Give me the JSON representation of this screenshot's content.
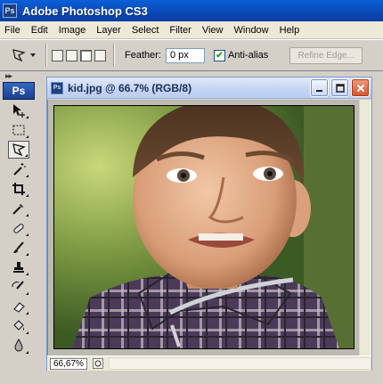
{
  "app": {
    "title": "Adobe Photoshop CS3",
    "logo_text": "Ps"
  },
  "menu": {
    "items": [
      "File",
      "Edit",
      "Image",
      "Layer",
      "Select",
      "Filter",
      "View",
      "Window",
      "Help"
    ]
  },
  "options": {
    "feather_label": "Feather:",
    "feather_value": "0 px",
    "antialias_label": "Anti-alias",
    "antialias_checked": true,
    "refine_edge_label": "Refine Edge..."
  },
  "toolbox": {
    "grip": "▸▸",
    "logo_text": "Ps",
    "tools": [
      {
        "icon": "move-tool-icon"
      },
      {
        "icon": "marquee-tool-icon"
      },
      {
        "icon": "lasso-tool-icon",
        "active": true
      },
      {
        "icon": "magic-wand-tool-icon"
      },
      {
        "icon": "crop-tool-icon"
      },
      {
        "icon": "eyedropper-tool-icon"
      },
      {
        "icon": "healing-brush-tool-icon"
      },
      {
        "icon": "brush-tool-icon"
      },
      {
        "icon": "clone-stamp-tool-icon"
      },
      {
        "icon": "history-brush-tool-icon"
      },
      {
        "icon": "eraser-tool-icon"
      },
      {
        "icon": "paint-bucket-tool-icon"
      },
      {
        "icon": "blur-tool-icon"
      }
    ]
  },
  "document": {
    "title": "kid.jpg @ 66.7% (RGB/8)",
    "icon_text": "Ps",
    "zoom": "66,67%"
  },
  "colors": {
    "titlebar": "#0b4fbf",
    "menubar": "#ece9d8",
    "panel": "#d4d0c8",
    "close_button": "#d8532f"
  }
}
